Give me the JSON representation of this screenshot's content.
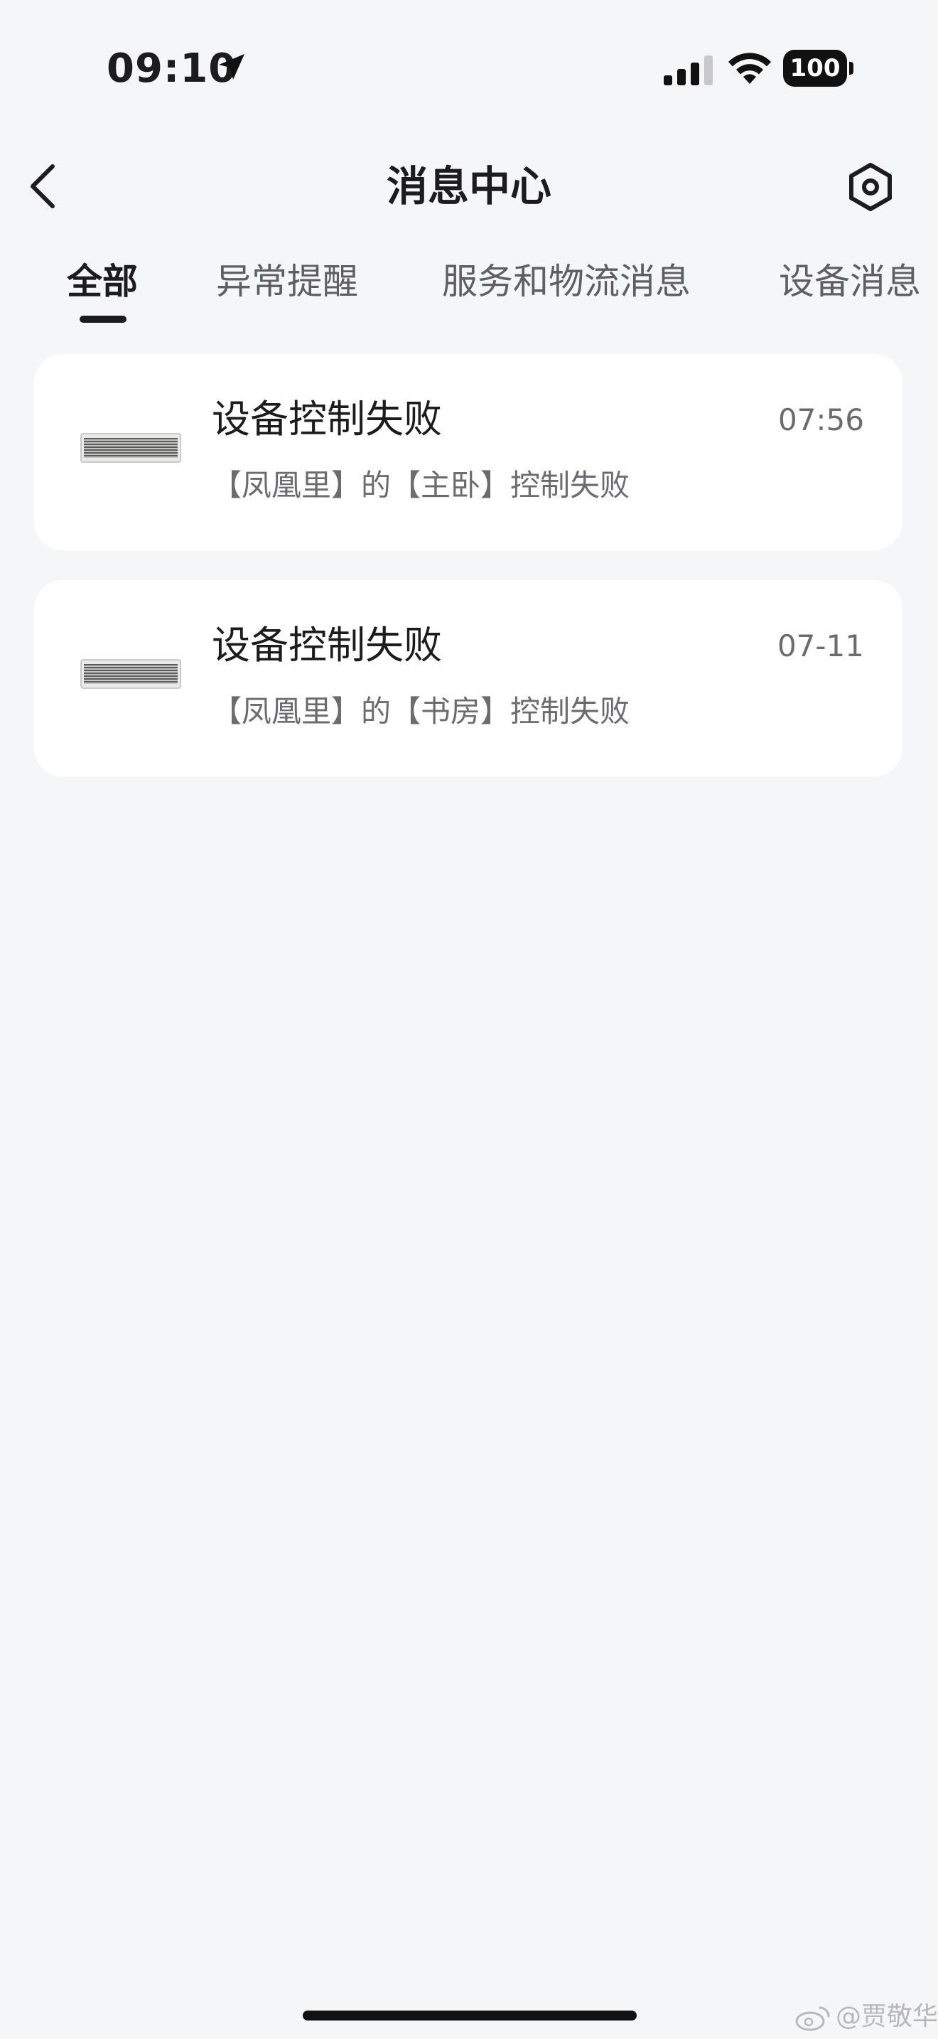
{
  "status_bar": {
    "time": "09:10",
    "battery": "100",
    "location_icon": "location-arrow-icon",
    "signal_icon": "cellular-signal-icon",
    "wifi_icon": "wifi-icon"
  },
  "nav": {
    "title": "消息中心",
    "back_icon": "chevron-left-icon",
    "settings_icon": "hexagon-gear-icon"
  },
  "tabs": [
    {
      "label": "全部",
      "active": true
    },
    {
      "label": "异常提醒",
      "active": false
    },
    {
      "label": "服务和物流消息",
      "active": false
    },
    {
      "label": "设备消息",
      "active": false
    }
  ],
  "messages": [
    {
      "title": "设备控制失败",
      "time": "07:56",
      "desc": "【凤凰里】的【主卧】控制失败",
      "thumb_icon": "air-conditioner-icon"
    },
    {
      "title": "设备控制失败",
      "time": "07-11",
      "desc": "【凤凰里】的【书房】控制失败",
      "thumb_icon": "air-conditioner-icon"
    }
  ],
  "watermark": {
    "text": "@贾敬华",
    "icon": "weibo-icon"
  },
  "colors": {
    "background": "#f5f6f8",
    "card": "#ffffff",
    "primary_text": "#1c1c1e",
    "secondary_text": "#6b6b70"
  }
}
